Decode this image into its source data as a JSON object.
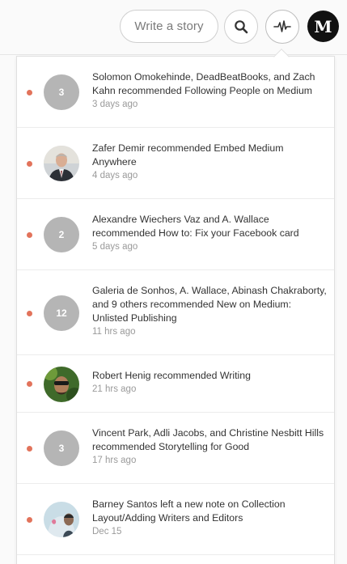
{
  "header": {
    "write_label": "Write a story",
    "search_icon": "search-icon",
    "activity_icon": "activity-pulse-icon",
    "logo_letter": "M"
  },
  "colors": {
    "unread_dot": "#e2735b",
    "count_badge": "#b5b5b5"
  },
  "notifications": [
    {
      "avatar": "3",
      "text": "Solomon Omokehinde, DeadBeatBooks, and Zach Kahn recommended Following People on Medium",
      "time": "3 days ago"
    },
    {
      "avatar": "",
      "text": "Zafer Demir recommended Embed Medium Anywhere",
      "time": "4 days ago"
    },
    {
      "avatar": "2",
      "text": "Alexandre Wiechers Vaz and A. Wallace recommended How to: Fix your Facebook card",
      "time": "5 days ago"
    },
    {
      "avatar": "12",
      "text": "Galeria de Sonhos, A. Wallace, Abinash Chakraborty, and 9 others recommended New on Medium: Unlisted Publishing",
      "time": "11 hrs ago"
    },
    {
      "avatar": "",
      "text": "Robert Henig recommended Writing",
      "time": "21 hrs ago"
    },
    {
      "avatar": "3",
      "text": "Vincent Park, Adli Jacobs, and Christine Nesbitt Hills recommended Storytelling for Good",
      "time": "17 hrs ago"
    },
    {
      "avatar": "",
      "text": "Barney Santos left a new note on Collection Layout/Adding Writers and Editors",
      "time": "Dec 15"
    }
  ]
}
